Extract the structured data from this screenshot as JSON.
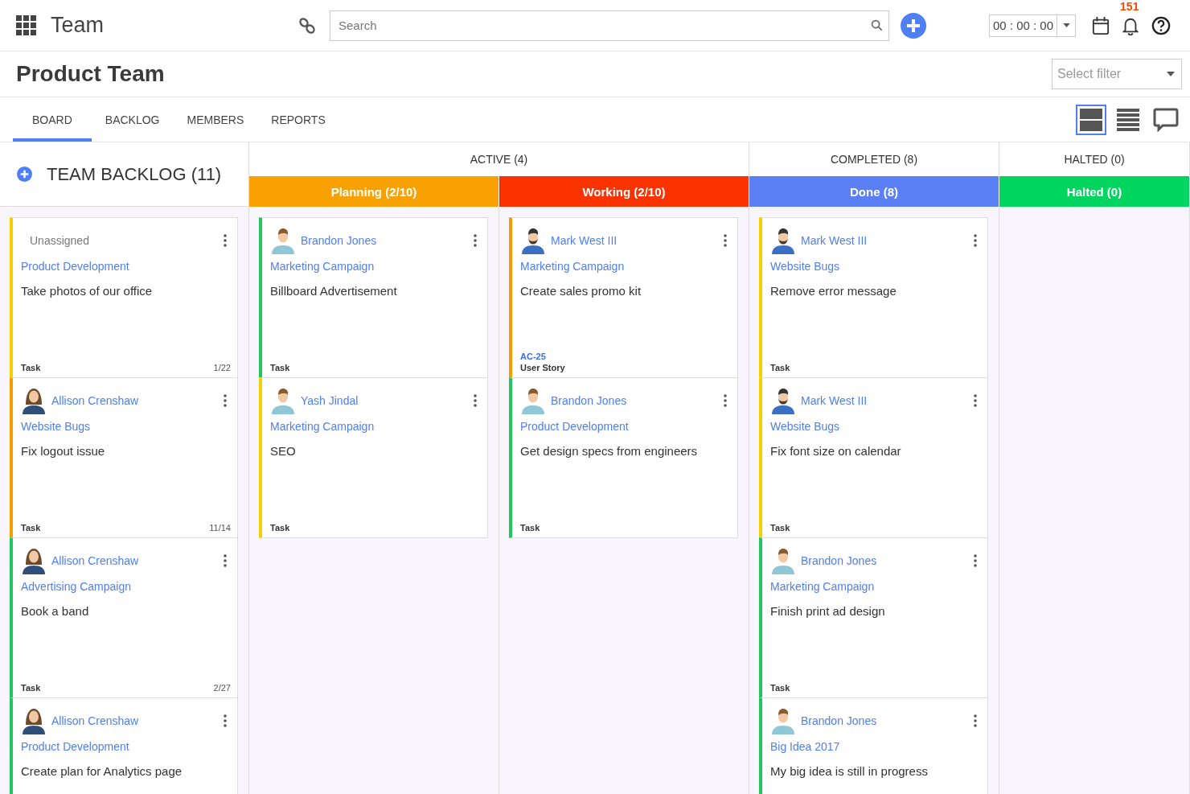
{
  "app": {
    "title": "Team",
    "notification_count": "151",
    "timer": "00 : 00 : 00"
  },
  "search": {
    "placeholder": "Search"
  },
  "page": {
    "title": "Product Team",
    "filter_placeholder": "Select filter"
  },
  "tabs": [
    {
      "label": "BOARD",
      "selected": true
    },
    {
      "label": "BACKLOG",
      "selected": false
    },
    {
      "label": "MEMBERS",
      "selected": false
    },
    {
      "label": "REPORTS",
      "selected": false
    }
  ],
  "view_buttons": [
    {
      "kind": "board",
      "selected": true
    },
    {
      "kind": "list",
      "selected": false
    },
    {
      "kind": "chat",
      "selected": false
    }
  ],
  "backlog": {
    "title": "TEAM BACKLOG (11)",
    "cards": [
      {
        "assignee": {
          "name": "Unassigned",
          "kind": "unassigned"
        },
        "project": "Product Development",
        "title": "Take photos of our office",
        "type": "Task",
        "count": "1/22",
        "color": "#f5d000"
      },
      {
        "assignee": {
          "name": "Allison Crenshaw",
          "kind": "woman"
        },
        "project": "Website Bugs",
        "title": "Fix logout issue",
        "type": "Task",
        "count": "11/14",
        "color": "#f59d00"
      },
      {
        "assignee": {
          "name": "Allison Crenshaw",
          "kind": "woman"
        },
        "project": "Advertising Campaign",
        "title": "Book a band",
        "type": "Task",
        "count": "2/27",
        "color": "#22c55e"
      },
      {
        "assignee": {
          "name": "Allison Crenshaw",
          "kind": "woman"
        },
        "project": "Product Development",
        "title": "Create plan for Analytics page",
        "color": "#22c55e"
      }
    ]
  },
  "groups": [
    {
      "label": "ACTIVE (4)",
      "lanes": [
        {
          "label": "Planning (2/10)",
          "color": "#f8a100",
          "cards": [
            {
              "assignee": {
                "name": "Brandon Jones",
                "kind": "man"
              },
              "project": "Marketing Campaign",
              "title": "Billboard Advertisement",
              "type": "Task",
              "color": "#22c55e"
            },
            {
              "assignee": {
                "name": "Yash Jindal",
                "kind": "man"
              },
              "project": "Marketing Campaign",
              "title": "SEO",
              "type": "Task",
              "color": "#f5d000"
            }
          ]
        },
        {
          "label": "Working (2/10)",
          "color": "#fb3300",
          "cards": [
            {
              "assignee": {
                "name": "Mark West III",
                "kind": "bearded"
              },
              "project": "Marketing Campaign",
              "title": "Create sales promo kit",
              "ticket": "AC-25",
              "type": "User Story",
              "color": "#f59d00"
            },
            {
              "assignee": {
                "name": "Brandon Jones",
                "kind": "man"
              },
              "project": "Product Development",
              "title": "Get design specs from engineers",
              "type": "Task",
              "color": "#22c55e"
            }
          ]
        }
      ]
    },
    {
      "label": "COMPLETED (8)",
      "lanes": [
        {
          "label": "Done (8)",
          "color": "#5b80f5",
          "cards": [
            {
              "assignee": {
                "name": "Mark West III",
                "kind": "bearded"
              },
              "project": "Website Bugs",
              "title": "Remove error message",
              "type": "Task",
              "color": "#f5d000"
            },
            {
              "assignee": {
                "name": "Mark West III",
                "kind": "bearded"
              },
              "project": "Website Bugs",
              "title": "Fix font size on calendar",
              "type": "Task",
              "color": "#f5d000"
            },
            {
              "assignee": {
                "name": "Brandon Jones",
                "kind": "man"
              },
              "project": "Marketing Campaign",
              "title": "Finish print ad design",
              "type": "Task",
              "color": "#22c55e"
            },
            {
              "assignee": {
                "name": "Brandon Jones",
                "kind": "man"
              },
              "project": "Big Idea 2017",
              "title": "My big idea is still in progress",
              "color": "#22c55e"
            }
          ]
        }
      ]
    },
    {
      "label": "HALTED (0)",
      "lanes": [
        {
          "label": "Halted (0)",
          "color": "#00d65f"
        }
      ]
    }
  ]
}
